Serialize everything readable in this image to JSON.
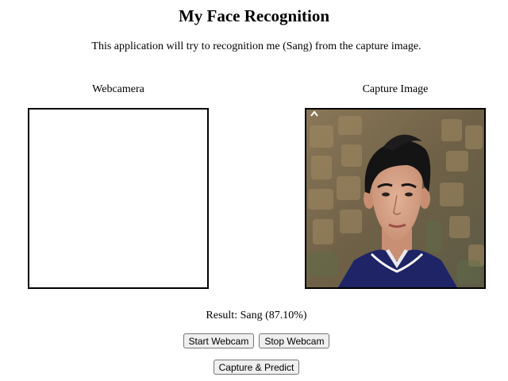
{
  "header": {
    "title": "My Face Recognition",
    "subtitle": "This application will try to recognition me (Sang) from the capture image."
  },
  "panels": {
    "webcam_label": "Webcamera",
    "capture_label": "Capture Image",
    "capture_image_icon": "person-photo"
  },
  "result": {
    "text": "Result: Sang (87.10%)"
  },
  "buttons": {
    "start_webcam": "Start Webcam",
    "stop_webcam": "Stop Webcam",
    "capture_predict": "Capture & Predict"
  },
  "colors": {
    "border": "#000000",
    "background": "#ffffff",
    "button_bg": "#efefef",
    "button_border": "#767676"
  }
}
